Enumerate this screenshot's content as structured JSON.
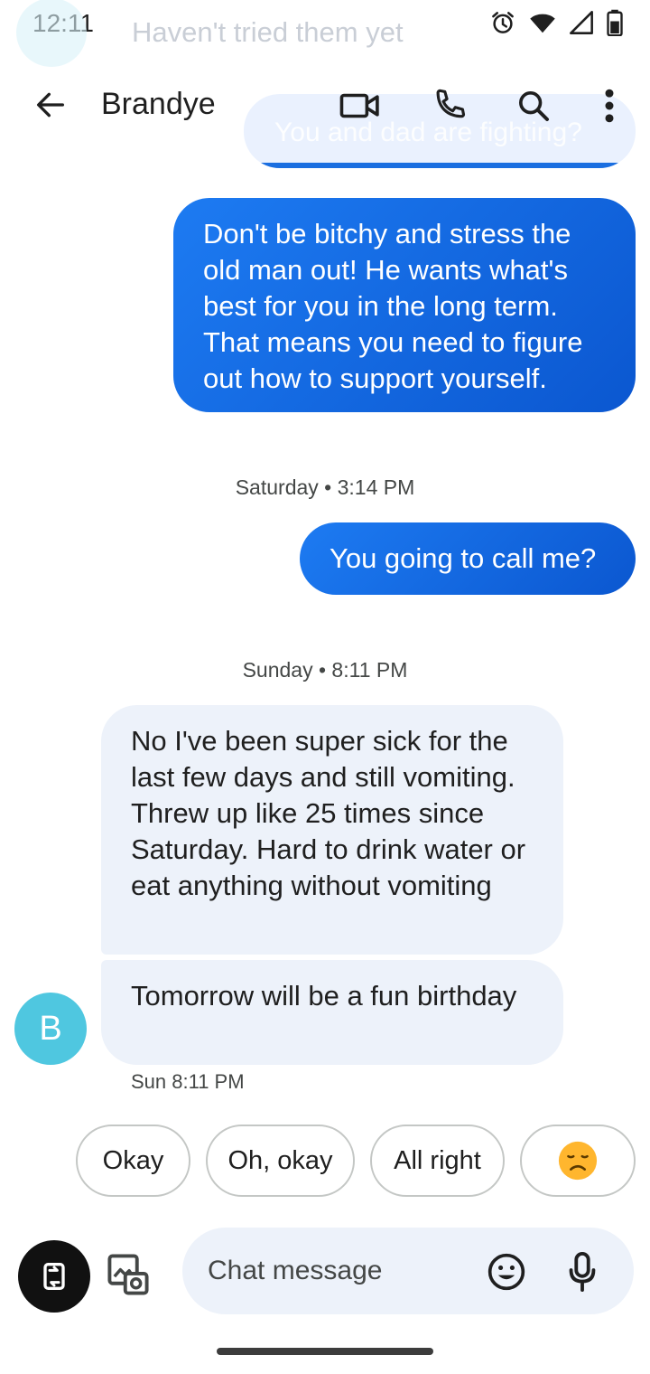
{
  "status_bar": {
    "time": "12:11"
  },
  "ghost": {
    "text": "Haven't tried them yet",
    "bubble_text": "You and dad are fighting?"
  },
  "header": {
    "contact_name": "Brandye"
  },
  "messages": [
    {
      "direction": "outgoing",
      "text": "Don't be bitchy and stress the old man out! He wants what's best for you in the long term. That means you need to figure out how to support yourself."
    },
    {
      "direction": "outgoing",
      "text": "You going to call me?"
    },
    {
      "direction": "incoming",
      "text": "No I've been super sick for the last few days and still vomiting. Threw up like 25 times since Saturday. Hard to drink water or eat anything without vomiting"
    },
    {
      "direction": "incoming",
      "text": "Tomorrow will be a fun birthday"
    }
  ],
  "timestamps": [
    "Saturday • 3:14 PM",
    "Sunday • 8:11 PM"
  ],
  "last_message_time": "Sun 8:11 PM",
  "avatar_letter": "B",
  "smart_replies": [
    "Okay",
    "Oh, okay",
    "All right",
    "😞"
  ],
  "composer": {
    "placeholder": "Chat message"
  },
  "colors": {
    "outgoing_bubble": "#0b57d0",
    "incoming_bubble": "#edf2fa",
    "avatar": "#4fc7e0"
  },
  "icons": [
    "alarm-icon",
    "wifi-icon",
    "signal-icon",
    "battery-icon",
    "back-arrow-icon",
    "video-call-icon",
    "phone-icon",
    "search-icon",
    "more-vert-icon",
    "attach-icon",
    "gallery-icon",
    "emoji-icon",
    "mic-icon"
  ]
}
